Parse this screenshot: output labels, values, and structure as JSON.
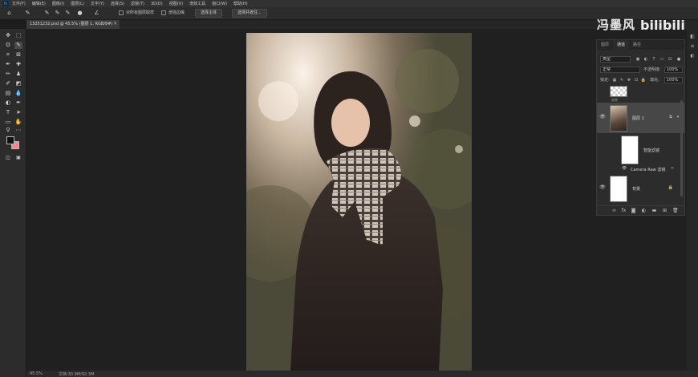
{
  "menubar": {
    "app_icon": "Ps",
    "items": [
      "文件(F)",
      "编辑(E)",
      "图像(I)",
      "图层(L)",
      "文字(Y)",
      "选择(S)",
      "滤镜(T)",
      "3D(D)",
      "视图(V)",
      "增效工具",
      "窗口(W)",
      "帮助(H)"
    ]
  },
  "options_bar": {
    "sample_all_layers": "对所有图层取样",
    "auto_enhance": "增强边缘",
    "select_subject": "选择主体",
    "select_and_mask": "选择并遮住..."
  },
  "document_tab": {
    "title": "13251232.psd @ 45.5% (图层 1, RGB/8#) *",
    "close": "×"
  },
  "watermark": {
    "name": "冯墨风",
    "logo_text": "bilibili"
  },
  "layers_panel": {
    "tabs": [
      "图层",
      "通道",
      "路径"
    ],
    "active_tab": 1,
    "kind_filter": "类型",
    "blend_mode": "正常",
    "opacity_label": "不透明度:",
    "opacity_value": "100%",
    "lock_label": "锁定:",
    "fill_label": "填充:",
    "fill_value": "100%",
    "partial_layer_label": "效果",
    "layers": [
      {
        "name": "图层 1",
        "selected": true
      },
      {
        "name": "智能滤镜"
      },
      {
        "name": "Camera Raw 滤镜"
      },
      {
        "name": "背景"
      }
    ]
  },
  "status": {
    "zoom": "45.5%",
    "doc_info": "文档:30.9M/92.3M"
  },
  "colors": {
    "foreground": "#111111",
    "background": "#e98a94"
  }
}
